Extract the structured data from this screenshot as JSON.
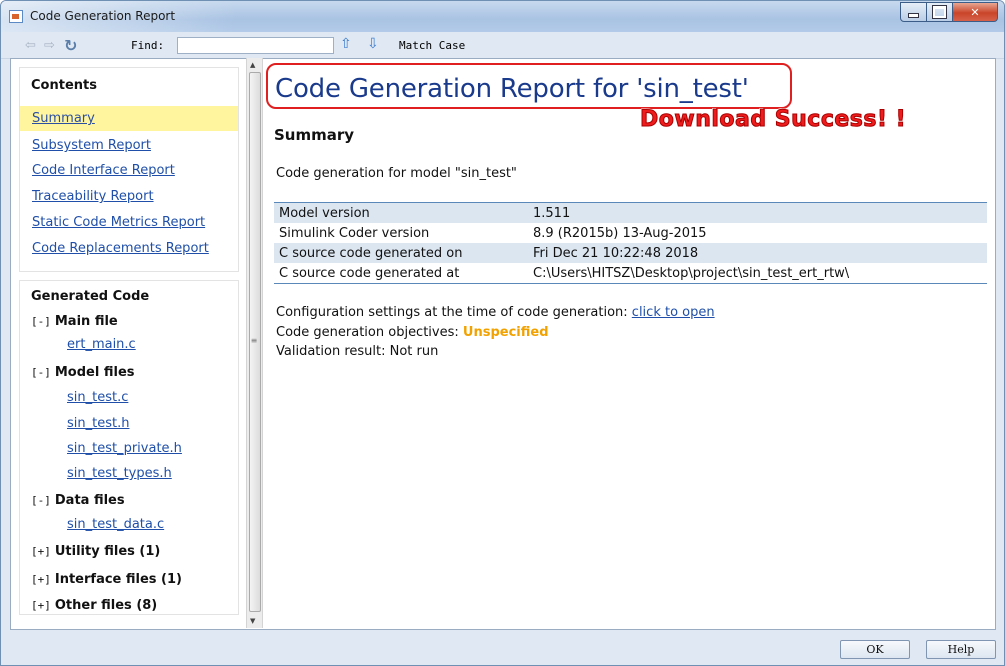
{
  "window": {
    "title": "Code Generation Report"
  },
  "toolbar": {
    "find_label": "Find:",
    "find_value": "",
    "match_case_label": "Match Case"
  },
  "sidebar": {
    "contents_heading": "Contents",
    "contents_links": [
      {
        "label": "Summary"
      },
      {
        "label": "Subsystem Report"
      },
      {
        "label": "Code Interface Report"
      },
      {
        "label": "Traceability Report"
      },
      {
        "label": "Static Code Metrics Report"
      },
      {
        "label": "Code Replacements Report"
      }
    ],
    "generated_heading": "Generated Code",
    "sections": [
      {
        "toggle": "[-]",
        "label": "Main file",
        "files": [
          "ert_main.c"
        ]
      },
      {
        "toggle": "[-]",
        "label": "Model files",
        "files": [
          "sin_test.c",
          "sin_test.h",
          "sin_test_private.h",
          "sin_test_types.h"
        ]
      },
      {
        "toggle": "[-]",
        "label": "Data files",
        "files": [
          "sin_test_data.c"
        ]
      },
      {
        "toggle": "[+]",
        "label": "Utility files (1)",
        "files": []
      },
      {
        "toggle": "[+]",
        "label": "Interface files (1)",
        "files": []
      },
      {
        "toggle": "[+]",
        "label": "Other files (8)",
        "files": []
      }
    ]
  },
  "main": {
    "title": "Code Generation Report for 'sin_test'",
    "annotation": "Download Success! !",
    "summary_heading": "Summary",
    "code_gen_text": "Code generation for model \"sin_test\"",
    "info_rows": [
      {
        "key": "Model version",
        "value": "1.511"
      },
      {
        "key": "Simulink Coder version",
        "value": "8.9 (R2015b) 13-Aug-2015"
      },
      {
        "key": "C source code generated on",
        "value": "Fri Dec 21 10:22:48 2018"
      },
      {
        "key": "C source code generated at",
        "value": "C:\\Users\\HITSZ\\Desktop\\project\\sin_test_ert_rtw\\"
      }
    ],
    "config_prefix": "Configuration settings at the time of code generation: ",
    "config_link": "click to open",
    "objectives_prefix": "Code generation objectives: ",
    "objectives_value": "Unspecified",
    "validation_text": "Validation result: Not run"
  },
  "buttons": {
    "ok": "OK",
    "help": "Help"
  },
  "colors": {
    "accent_link": "#1f4fa8",
    "title_blue": "#1a3a8c",
    "highlight_yellow": "#fff59f",
    "annotation_red": "#ee1c1c",
    "unspecified_orange": "#f2a200"
  }
}
